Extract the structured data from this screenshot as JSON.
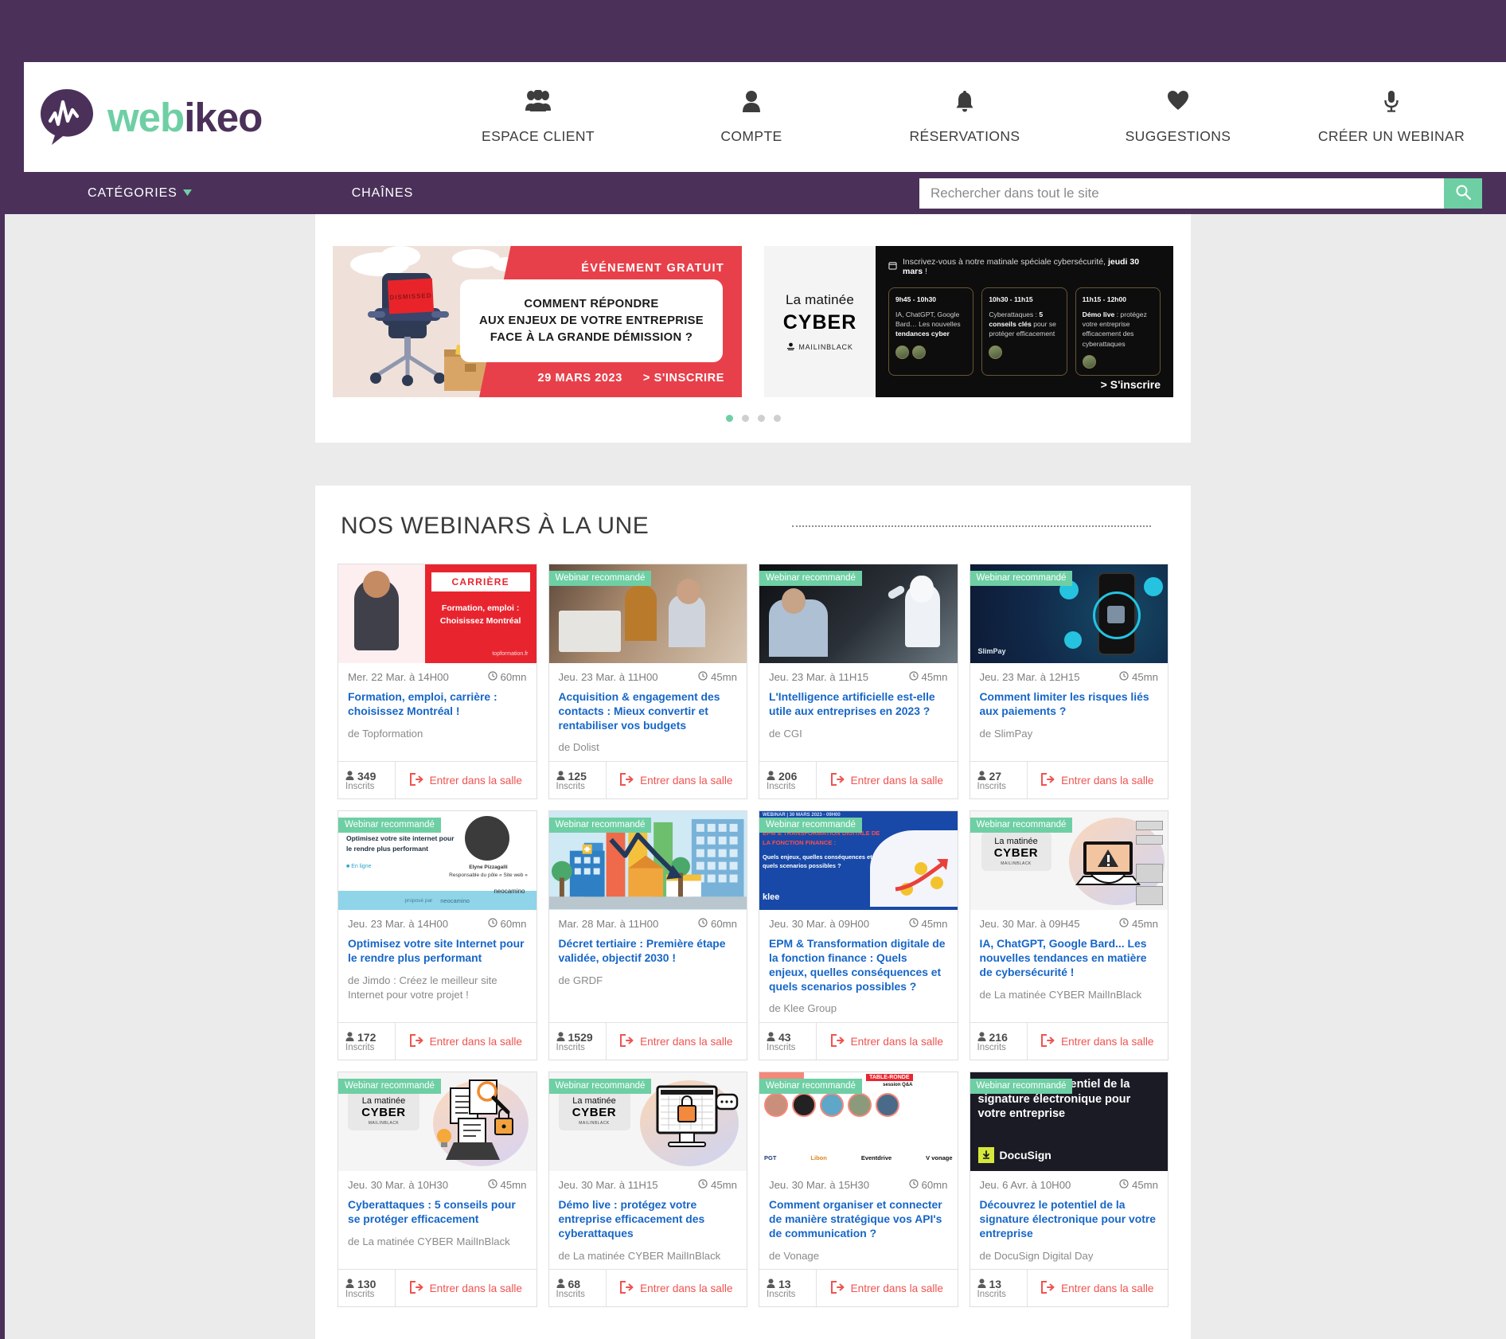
{
  "header": {
    "logo_text_1": "web",
    "logo_text_2": "ikeo",
    "nav": [
      {
        "label": "ESPACE CLIENT",
        "icon": "users-icon"
      },
      {
        "label": "COMPTE",
        "icon": "user-icon"
      },
      {
        "label": "RÉSERVATIONS",
        "icon": "bell-icon"
      },
      {
        "label": "SUGGESTIONS",
        "icon": "heart-icon"
      },
      {
        "label": "CRÉER UN WEBINAR",
        "icon": "microphone-icon"
      }
    ]
  },
  "subnav": {
    "categories": "CATÉGORIES",
    "chaines": "CHAÎNES",
    "search_placeholder": "Rechercher dans tout le site",
    "search_value": ""
  },
  "carousel": {
    "banner_a": {
      "tag": "ÉVÉNEMENT GRATUIT",
      "title_line1": "COMMENT RÉPONDRE",
      "title_line2": "AUX ENJEUX DE VOTRE ENTREPRISE",
      "title_line3": "FACE À LA GRANDE DÉMISSION ?",
      "date": "29 MARS 2023",
      "cta": "> S'INSCRIRE",
      "chair_label": "DISMISSED"
    },
    "banner_b": {
      "brand_line1": "La matinée",
      "brand_line2": "CYBER",
      "brand_line3": "MAILINBLACK",
      "intro_plain": "Inscrivez-vous à notre matinale spéciale cybersécurité,",
      "intro_bold": "jeudi 30 mars",
      "intro_end": "!",
      "slots": [
        {
          "time": "9h45 - 10h30",
          "d1": "IA, ChatGPT, Google Bard… Les nouvelles ",
          "d2": "tendances cyber",
          "d3": "",
          "avatars": 2
        },
        {
          "time": "10h30 - 11h15",
          "d1": "Cyberattaques : ",
          "d2": "5 conseils clés",
          "d3": " pour se protéger efficacement",
          "avatars": 1
        },
        {
          "time": "11h15 - 12h00",
          "d1": "",
          "d2": "Démo live",
          "d3": " : protégez votre entreprise efficacement des cyberattaques",
          "avatars": 1
        }
      ],
      "cta": "> S'inscrire"
    },
    "dots": 4,
    "active_dot": 0
  },
  "featured": {
    "title": "NOS WEBINARS À LA UNE",
    "recommended_badge": "Webinar recommandé",
    "enter_label": "Entrer dans la salle",
    "inscrits_label": "Inscrits",
    "cards": [
      {
        "badge": false,
        "date": "Mer. 22 Mar. à 14H00",
        "duration": "60mn",
        "title": "Formation, emploi, carrière : choisissez Montréal !",
        "author": "de Topformation",
        "registered": "349",
        "thumb": {
          "style": "carriere",
          "kicker": "CARRIÈRE",
          "l1": "Formation, emploi :",
          "l2": "Choisissez Montréal",
          "brand": "topformation.fr"
        }
      },
      {
        "badge": true,
        "date": "Jeu. 23 Mar. à 11H00",
        "duration": "45mn",
        "title": "Acquisition & engagement des contacts : Mieux convertir et rentabiliser vos budgets",
        "author": "de Dolist",
        "registered": "125",
        "thumb": {
          "style": "photo-office"
        }
      },
      {
        "badge": true,
        "date": "Jeu. 23 Mar. à 11H15",
        "duration": "45mn",
        "title": "L'Intelligence artificielle est-elle utile aux entreprises en 2023 ?",
        "author": "de CGI",
        "registered": "206",
        "thumb": {
          "style": "photo-robot"
        }
      },
      {
        "badge": true,
        "date": "Jeu. 23 Mar. à 12H15",
        "duration": "45mn",
        "title": "Comment limiter les risques liés aux paiements ?",
        "author": "de SlimPay",
        "registered": "27",
        "thumb": {
          "style": "slimpay",
          "brand": "SlimPay"
        }
      },
      {
        "badge": true,
        "date": "Jeu. 23 Mar. à 14H00",
        "duration": "60mn",
        "title": "Optimisez votre site Internet pour le rendre plus performant",
        "author": "de Jimdo : Créez le meilleur site Internet pour votre projet !",
        "registered": "172",
        "thumb": {
          "style": "neocamino",
          "l1": "Optimisez votre site internet pour le rendre plus performant",
          "online": "En ligne",
          "person": "Elyne Pizzagalli",
          "role": "Responsable du pôle « Site web »",
          "brand": "neocamino",
          "footer": "proposé par"
        }
      },
      {
        "badge": true,
        "date": "Mar. 28 Mar. à 11H00",
        "duration": "60mn",
        "title": "Décret tertiaire : Première étape validée, objectif 2030 !",
        "author": "de GRDF",
        "registered": "1529",
        "thumb": {
          "style": "city-chart"
        }
      },
      {
        "badge": true,
        "date": "Jeu. 30 Mar. à 09H00",
        "duration": "45mn",
        "title": "EPM & Transformation digitale de la fonction finance : Quels enjeux, quelles conséquences et quels scenarios possibles ?",
        "author": "de Klee Group",
        "registered": "43",
        "thumb": {
          "style": "klee",
          "kicker": "WEBINAR | 30 MARS 2023 - 09H00",
          "l1": "EPM & TRANSFORMATION DIGITALE DE LA FONCTION FINANCE :",
          "l2": "Quels enjeux, quelles conséquences et quels scenarios possibles ?",
          "brand": "klee"
        }
      },
      {
        "badge": true,
        "date": "Jeu. 30 Mar. à 09H45",
        "duration": "45mn",
        "title": "IA, ChatGPT, Google Bard... Les nouvelles tendances en matière de cybersécurité !",
        "author": "de La matinée CYBER MailInBlack",
        "registered": "216",
        "thumb": {
          "style": "cyber-laptop",
          "c1": "La matinée",
          "c2": "CYBER",
          "c3": "MAILINBLACK"
        }
      },
      {
        "badge": true,
        "date": "Jeu. 30 Mar. à 10H30",
        "duration": "45mn",
        "title": "Cyberattaques : 5 conseils pour se protéger efficacement",
        "author": "de La matinée CYBER MailInBlack",
        "registered": "130",
        "thumb": {
          "style": "cyber-docs",
          "c1": "La matinée",
          "c2": "CYBER",
          "c3": "MAILINBLACK"
        }
      },
      {
        "badge": true,
        "date": "Jeu. 30 Mar. à 11H15",
        "duration": "45mn",
        "title": "Démo live : protégez votre entreprise efficacement des cyberattaques",
        "author": "de La matinée CYBER MailInBlack",
        "registered": "68",
        "thumb": {
          "style": "cyber-screen",
          "c1": "La matinée",
          "c2": "CYBER",
          "c3": "MAILINBLACK"
        }
      },
      {
        "badge": true,
        "date": "Jeu. 30 Mar. à 15H30",
        "duration": "60mn",
        "title": "Comment organiser et connecter de manière stratégique vos API's de communication ?",
        "author": "de Vonage",
        "registered": "13",
        "thumb": {
          "style": "panel",
          "kicker": "TABLE-RONDE",
          "kicker2": "session Q&A",
          "brands": [
            "PGT",
            "Libon",
            "Eventdrive",
            "V vonage"
          ]
        }
      },
      {
        "badge": true,
        "date": "Jeu. 6 Avr. à 10H00",
        "duration": "45mn",
        "title": "Découvrez le potentiel de la signature électronique pour votre entreprise",
        "author": "de DocuSign Digital Day",
        "registered": "13",
        "thumb": {
          "style": "docusign",
          "l1": "Découvrez le potentiel de",
          "l2": "la signature électronique",
          "l3": "pour votre entreprise",
          "brand": "DocuSign"
        }
      }
    ]
  },
  "colors": {
    "purple": "#4b3159",
    "green": "#6ecfa4",
    "blue_link": "#1666c8",
    "red_cta": "#ef5350"
  }
}
